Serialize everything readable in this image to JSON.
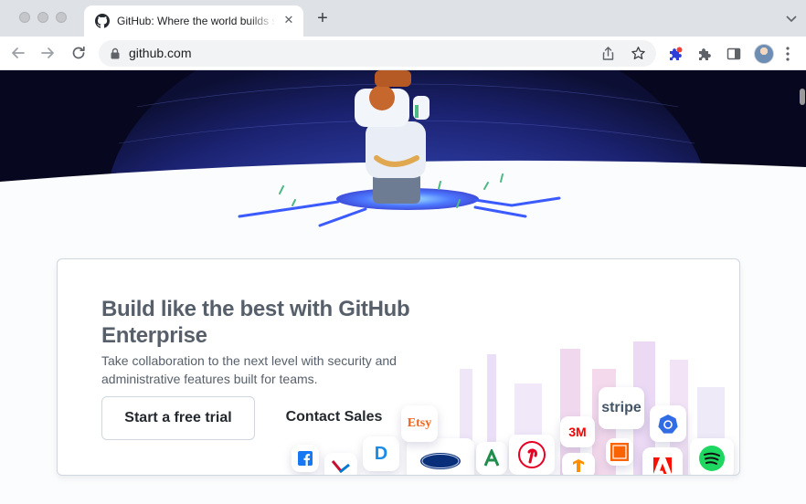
{
  "browser": {
    "tab": {
      "title": "GitHub: Where the world builds software",
      "close_glyph": "✕"
    },
    "new_tab_glyph": "+",
    "address": {
      "url": "github.com"
    },
    "icons": {
      "tab_favicon": "github-octocat-icon",
      "back": "arrow-left-icon",
      "forward": "arrow-right-icon",
      "reload": "reload-icon",
      "lock": "lock-icon",
      "share": "share-icon",
      "bookmark": "star-icon",
      "extension": "puzzle-extension-icon",
      "extensions_menu": "puzzle-icon",
      "side_panel": "side-panel-icon",
      "menu": "kebab-menu-icon"
    }
  },
  "page": {
    "enterprise": {
      "title": "Build like the best with GitHub Enterprise",
      "description": "Take collaboration to the next level with security and administrative features built for teams.",
      "primary_cta": "Start a free trial",
      "secondary_cta": "Contact Sales"
    },
    "customer_logos": {
      "stripe": "stripe",
      "etsy": "Etsy",
      "threem": "3M",
      "ford": "Ford"
    }
  },
  "colors": {
    "heading": "#57606a",
    "button_text": "#24292f",
    "hero_dark": "#0b0d2e",
    "hero_globe": "#2b3a9c"
  }
}
